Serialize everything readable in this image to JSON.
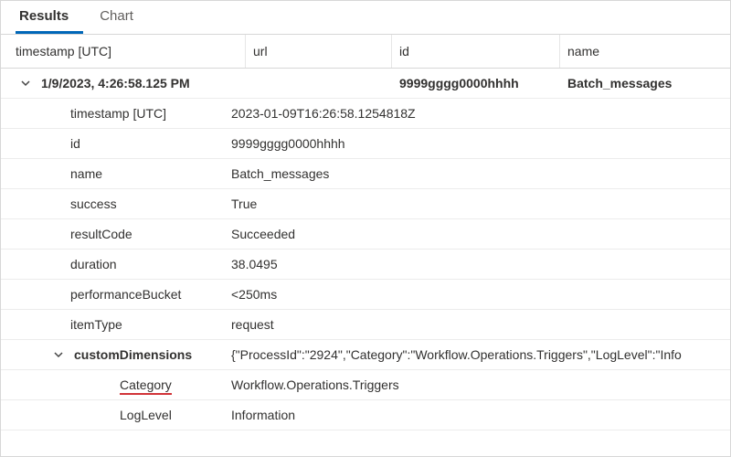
{
  "tabs": {
    "results": "Results",
    "chart": "Chart"
  },
  "columns": {
    "timestamp": "timestamp [UTC]",
    "url": "url",
    "id": "id",
    "name": "name"
  },
  "summary": {
    "timestamp": "1/9/2023, 4:26:58.125 PM",
    "url": "",
    "id": "9999gggg0000hhhh",
    "name": "Batch_messages"
  },
  "details": {
    "timestamp_label": "timestamp [UTC]",
    "timestamp_value": "2023-01-09T16:26:58.1254818Z",
    "id_label": "id",
    "id_value": "9999gggg0000hhhh",
    "name_label": "name",
    "name_value": "Batch_messages",
    "success_label": "success",
    "success_value": "True",
    "resultCode_label": "resultCode",
    "resultCode_value": "Succeeded",
    "duration_label": "duration",
    "duration_value": "38.0495",
    "performanceBucket_label": "performanceBucket",
    "performanceBucket_value": "<250ms",
    "itemType_label": "itemType",
    "itemType_value": "request"
  },
  "customDimensions": {
    "label": "customDimensions",
    "raw": "{\"ProcessId\":\"2924\",\"Category\":\"Workflow.Operations.Triggers\",\"LogLevel\":\"Info",
    "category_label": "Category",
    "category_value": "Workflow.Operations.Triggers",
    "loglevel_label": "LogLevel",
    "loglevel_value": "Information"
  }
}
